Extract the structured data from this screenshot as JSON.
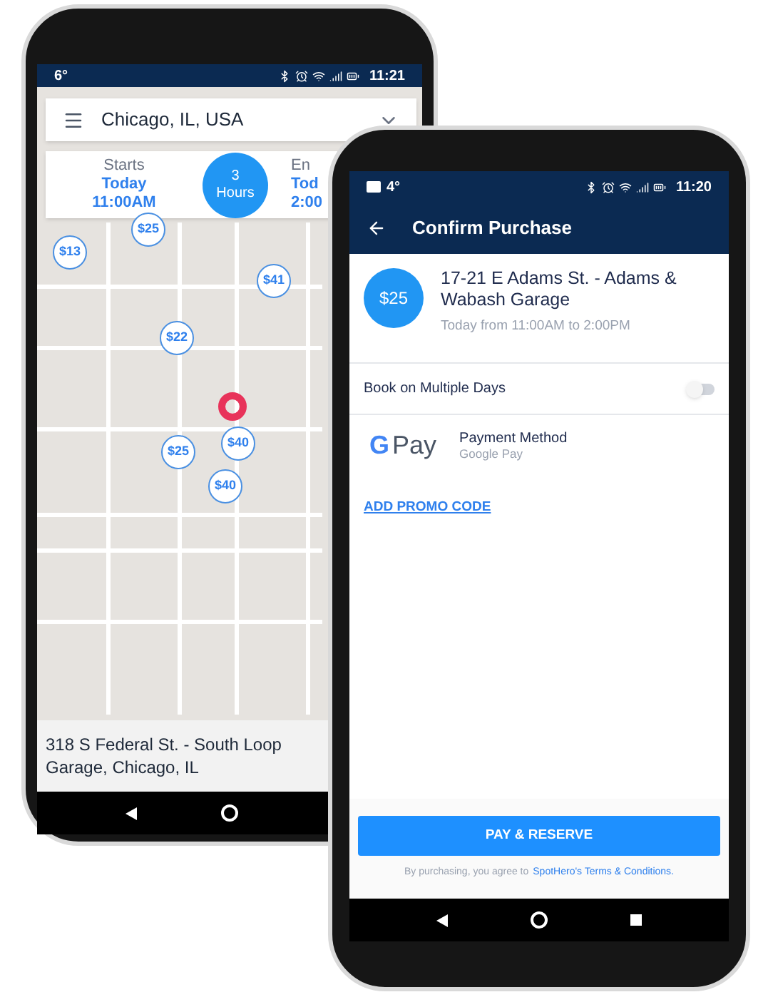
{
  "left_phone": {
    "status_bar": {
      "temperature": "6°",
      "time": "11:21"
    },
    "search": {
      "value": "Chicago, IL, USA"
    },
    "time_card": {
      "start": {
        "label": "Starts",
        "day": "Today",
        "time": "11:00AM"
      },
      "duration": {
        "value": "3",
        "unit": "Hours"
      },
      "end": {
        "label": "En",
        "day": "Tod",
        "time": "2:00"
      }
    },
    "pins": [
      {
        "price": "$25"
      },
      {
        "price": "$13"
      },
      {
        "price": "$41"
      },
      {
        "price": "$22"
      },
      {
        "price": "$25"
      },
      {
        "price": "$40"
      },
      {
        "price": "$40"
      }
    ],
    "selected_location": {
      "address": "318 S Federal St. - South Loop Garage, Chicago, IL"
    }
  },
  "right_phone": {
    "status_bar": {
      "temperature": "4°",
      "time": "11:20"
    },
    "header": {
      "title": "Confirm Purchase"
    },
    "spot": {
      "price": "$25",
      "name": "17-21 E Adams St. - Adams & Wabash Garage",
      "time": "Today from 11:00AM to 2:00PM"
    },
    "multiple_days": {
      "label": "Book on Multiple Days",
      "on": false
    },
    "payment": {
      "logo_g": "G",
      "logo_pay": "Pay",
      "label": "Payment Method",
      "value": "Google Pay"
    },
    "promo_link": "ADD PROMO CODE",
    "button": "PAY & RESERVE",
    "terms": {
      "text": "By purchasing, you agree to",
      "link": "SpotHero's Terms & Conditions."
    }
  }
}
